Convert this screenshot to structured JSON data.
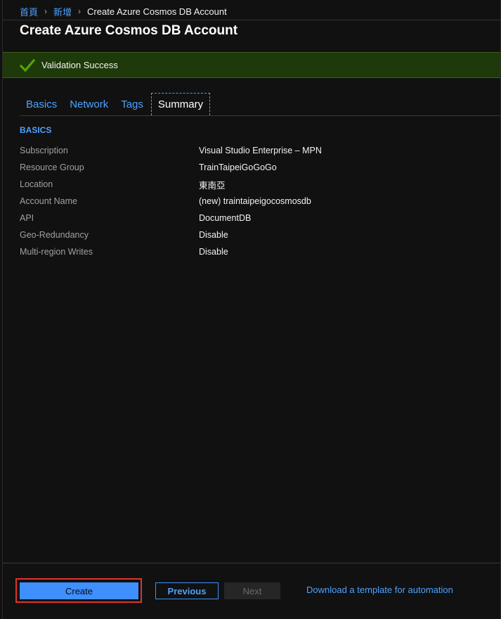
{
  "breadcrumb": {
    "items": [
      "首頁",
      "新增"
    ],
    "current": "Create Azure Cosmos DB Account"
  },
  "page": {
    "title": "Create Azure Cosmos DB Account"
  },
  "banner": {
    "text": "Validation Success",
    "icon": "checkmark-icon",
    "color": "#1e3a0a"
  },
  "tabs": [
    {
      "label": "Basics"
    },
    {
      "label": "Network"
    },
    {
      "label": "Tags"
    },
    {
      "label": "Summary",
      "active": true
    }
  ],
  "summary": {
    "section_title": "BASICS",
    "rows": [
      {
        "label": "Subscription",
        "value": "Visual Studio Enterprise – MPN"
      },
      {
        "label": "Resource Group",
        "value": "TrainTaipeiGoGoGo"
      },
      {
        "label": "Location",
        "value": "東南亞"
      },
      {
        "label": "Account Name",
        "value": "(new) traintaipeigocosmosdb"
      },
      {
        "label": "API",
        "value": "DocumentDB"
      },
      {
        "label": "Geo-Redundancy",
        "value": "Disable"
      },
      {
        "label": "Multi-region Writes",
        "value": "Disable"
      }
    ]
  },
  "footer": {
    "create_label": "Create",
    "previous_label": "Previous",
    "next_label": "Next",
    "template_link": "Download a template for automation"
  },
  "colors": {
    "accent": "#3f8fff",
    "highlight": "#e0342c",
    "success": "#57a300"
  }
}
